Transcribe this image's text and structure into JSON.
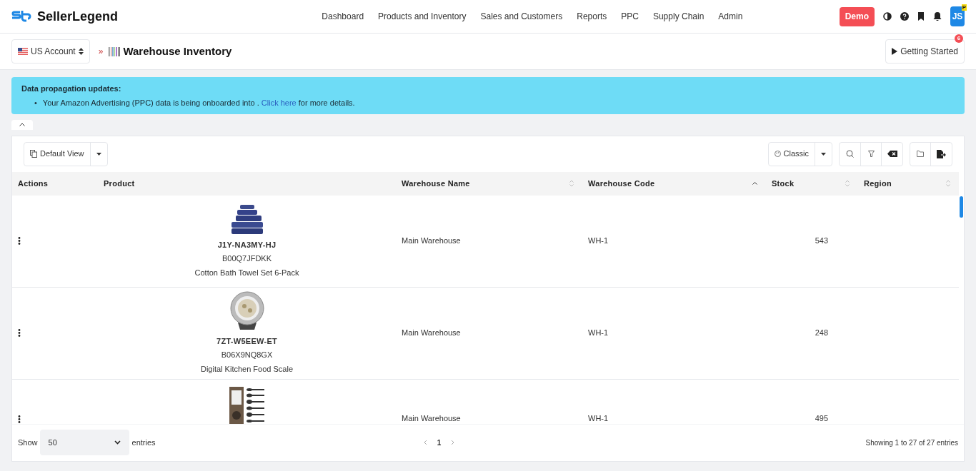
{
  "header": {
    "brand": "SellerLegend",
    "nav": [
      "Dashboard",
      "Products and Inventory",
      "Sales and Customers",
      "Reports",
      "PPC",
      "Supply Chain",
      "Admin"
    ],
    "demo": "Demo",
    "avatar": "JS",
    "avatar_badge": "P"
  },
  "subheader": {
    "account": "US Account",
    "separator": "»",
    "title": "Warehouse Inventory",
    "getting_started": "Getting Started",
    "getting_started_count": "6"
  },
  "alert": {
    "title": "Data propagation updates:",
    "items": [
      {
        "bullet": "•",
        "before": "Your Amazon Advertising (PPC) data is being onboarded into . ",
        "link": "Click here",
        "after": " for more details."
      }
    ]
  },
  "toolbar": {
    "view": "Default View",
    "layout": "Classic"
  },
  "table": {
    "columns": [
      {
        "label": "Actions"
      },
      {
        "label": "Product"
      },
      {
        "label": "Warehouse Name",
        "sortable": true,
        "sorted": false
      },
      {
        "label": "Warehouse Code",
        "sortable": true,
        "sorted": true
      },
      {
        "label": "Stock",
        "sortable": true,
        "sorted": false
      },
      {
        "label": "Region",
        "sortable": true,
        "sorted": false
      }
    ],
    "rows": [
      {
        "kind": "towels",
        "sku": "J1Y-NA3MY-HJ",
        "asin": "B00Q7JFDKK",
        "title": "Cotton Bath Towel Set 6-Pack",
        "warehouse_name": "Main Warehouse",
        "warehouse_code": "WH-1",
        "stock": "543"
      },
      {
        "kind": "scale",
        "sku": "7ZT-W5EEW-ET",
        "asin": "B06X9NQ8GX",
        "title": "Digital Kitchen Food Scale",
        "warehouse_name": "Main Warehouse",
        "warehouse_code": "WH-1",
        "stock": "248"
      },
      {
        "kind": "utensils",
        "warehouse_name": "Main Warehouse",
        "warehouse_code": "WH-1",
        "stock": "495"
      }
    ]
  },
  "footer": {
    "show": "Show",
    "page_size": "50",
    "entries": "entries",
    "page": "1",
    "summary": "Showing 1 to 27 of 27 entries"
  }
}
